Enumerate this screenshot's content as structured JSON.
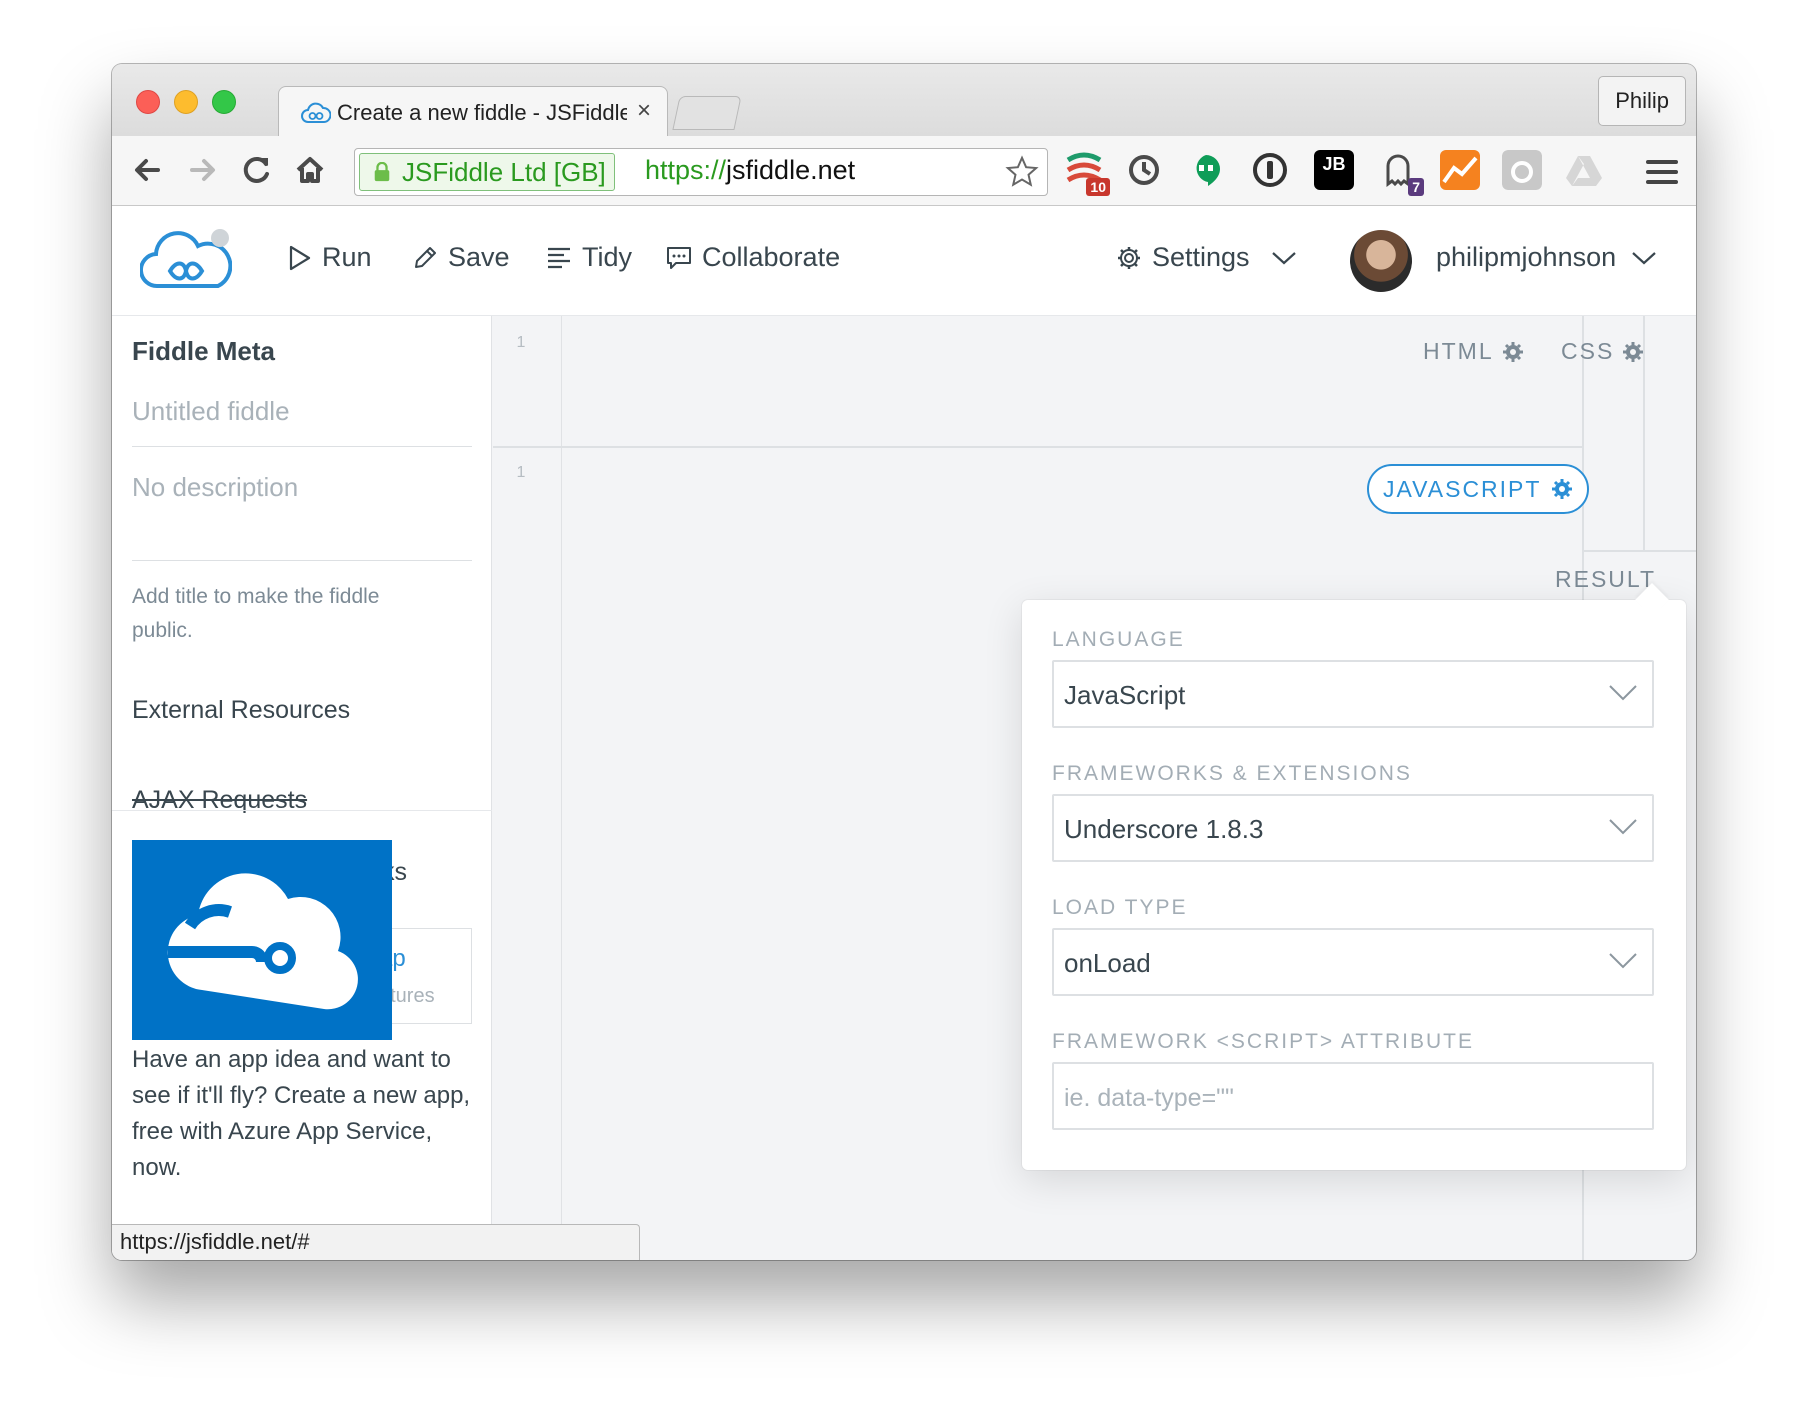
{
  "browser": {
    "tab_title": "Create a new fiddle - JSFiddle",
    "tab_close": "×",
    "profile": "Philip",
    "ev_org": "JSFiddle Ltd [GB]",
    "url_scheme": "https://",
    "url_host": "jsfiddle.net",
    "extension_badges": {
      "first": "10",
      "ghost": "7"
    },
    "status_url": "https://jsfiddle.net/#"
  },
  "header": {
    "run": "Run",
    "save": "Save",
    "tidy": "Tidy",
    "collaborate": "Collaborate",
    "settings": "Settings",
    "username": "philipmjohnson"
  },
  "sidebar": {
    "title": "Fiddle Meta",
    "title_placeholder": "Untitled fiddle",
    "description_placeholder": "No description",
    "note": "Add title to make the fiddle public.",
    "external_resources": "External Resources",
    "ajax_requests": "AJAX Requests",
    "frag_ks": "ks",
    "frag_ap": "ap",
    "frag_atures": "atures",
    "ad_text": "Have an app idea and want to see if it'll fly? Create a new app, free with Azure App Service, now."
  },
  "editors": {
    "line_number": "1",
    "html_label": "HTML",
    "css_label": "CSS",
    "js_label": "JAVASCRIPT",
    "result_label": "RESULT"
  },
  "js_settings": {
    "language_label": "LANGUAGE",
    "language_value": "JavaScript",
    "frameworks_label": "FRAMEWORKS & EXTENSIONS",
    "frameworks_value": "Underscore 1.8.3",
    "load_type_label": "LOAD TYPE",
    "load_type_value": "onLoad",
    "attribute_label": "FRAMEWORK <SCRIPT> ATTRIBUTE",
    "attribute_placeholder": "ie. data-type=\"\""
  },
  "colors": {
    "accent": "#2b8fd6",
    "azure_blue": "#0072c6",
    "ev_green": "#2a9a1f"
  },
  "icons": {
    "run": "play-icon",
    "save": "pencil-icon",
    "tidy": "align-left-icon",
    "collaborate": "chat-icon",
    "settings": "gear-icon"
  }
}
